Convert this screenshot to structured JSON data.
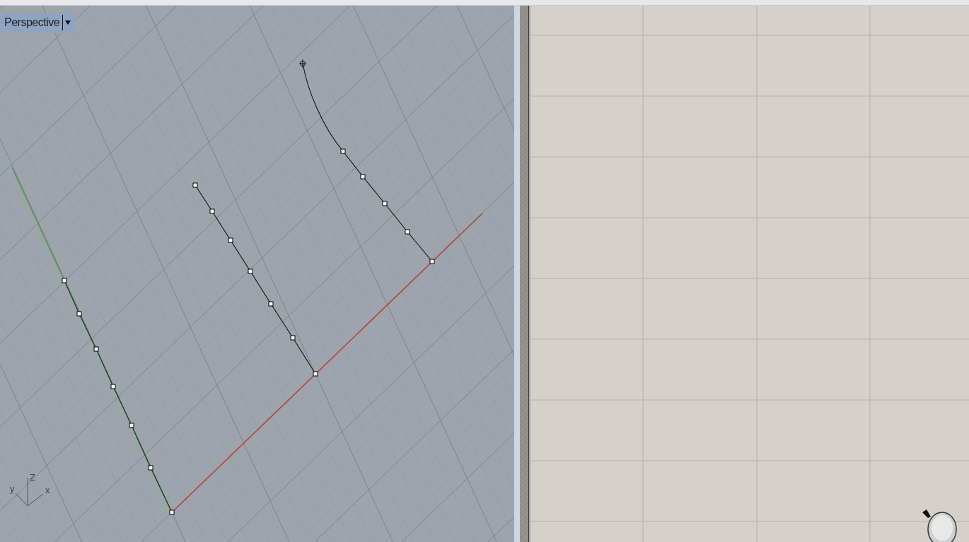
{
  "viewport": {
    "label": "Perspective",
    "axes": [
      "y",
      "Z",
      "x"
    ]
  }
}
